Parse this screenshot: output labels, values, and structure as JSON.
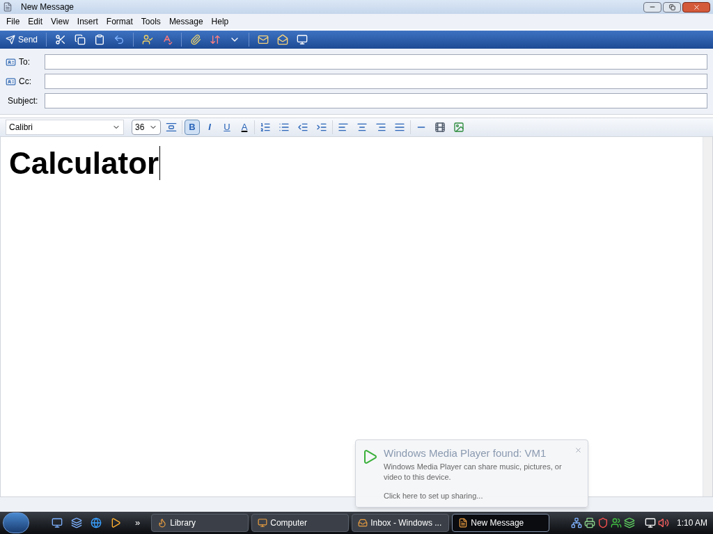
{
  "window": {
    "title": "New Message"
  },
  "menu": [
    "File",
    "Edit",
    "View",
    "Insert",
    "Format",
    "Tools",
    "Message",
    "Help"
  ],
  "toolbar": {
    "send_label": "Send"
  },
  "fields": [
    {
      "kind": "address",
      "label": "To:"
    },
    {
      "kind": "address",
      "label": "Cc:"
    },
    {
      "kind": "plain",
      "label": "Subject:"
    }
  ],
  "format_bar": {
    "font": "Calibri",
    "size": "36",
    "toggles": [
      {
        "label": "B",
        "selected": true
      },
      {
        "label": "I",
        "selected": false
      },
      {
        "label": "U",
        "selected": false
      }
    ],
    "color_label": "A"
  },
  "body": {
    "text": "Calculator"
  },
  "notification": {
    "title": "Windows Media Player found: VM1",
    "message": "Windows Media Player can share music, pictures, or video to this device.",
    "link": "Click here to set up sharing..."
  },
  "taskbar": {
    "overflow": "»",
    "buttons": [
      {
        "label": "Library",
        "selected": false
      },
      {
        "label": "Computer",
        "selected": false
      },
      {
        "label": "Inbox - Windows ...",
        "selected": false
      },
      {
        "label": "New Message",
        "selected": true
      }
    ],
    "clock": "1:10 AM"
  }
}
